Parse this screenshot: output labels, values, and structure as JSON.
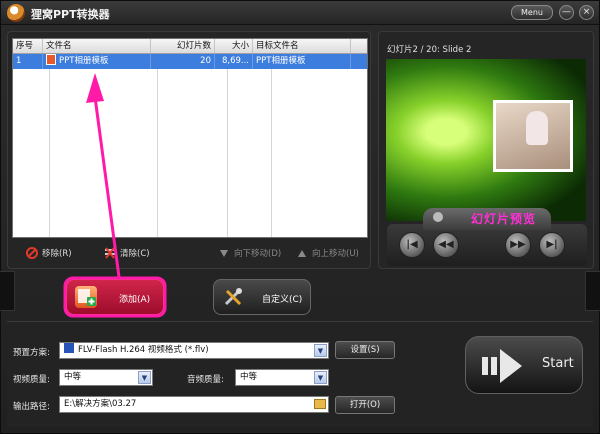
{
  "window": {
    "title": "狸窝PPT转换器",
    "menu_label": "Menu",
    "minimize": "—",
    "close": "×"
  },
  "table": {
    "columns": [
      "序号",
      "文件名",
      "幻灯片数",
      "大小",
      "目标文件名"
    ],
    "rows": [
      {
        "index": "1",
        "filename": "PPT相册模板",
        "slides": "20",
        "size": "8,69...",
        "target": "PPT相册模板"
      }
    ]
  },
  "list_toolbar": {
    "remove": "移除(R)",
    "clear": "清除(C)",
    "move_down": "向下移动(D)",
    "move_up": "向上移动(U)"
  },
  "preview": {
    "caption": "幻灯片2 / 20: Slide 2",
    "label": "幻灯片预览",
    "buttons": [
      "first",
      "prev",
      "next",
      "last"
    ]
  },
  "actions": {
    "add": "添加(A)",
    "customize": "自定义(C)"
  },
  "settings": {
    "preset_label": "预置方案:",
    "preset_value": "FLV-Flash H.264 视频格式 (*.flv)",
    "settings_button": "设置(S)",
    "video_quality_label": "视频质量:",
    "video_quality_value": "中等",
    "audio_quality_label": "音频质量:",
    "audio_quality_value": "中等",
    "output_label": "输出路径:",
    "output_value": "E:\\解决方案\\03.27",
    "open_button": "打开(O)",
    "start_button": "Start"
  },
  "colors": {
    "selection": "#3d7ddd",
    "preview_label": "#ff2fd6",
    "annotation": "#ff1aa8"
  }
}
